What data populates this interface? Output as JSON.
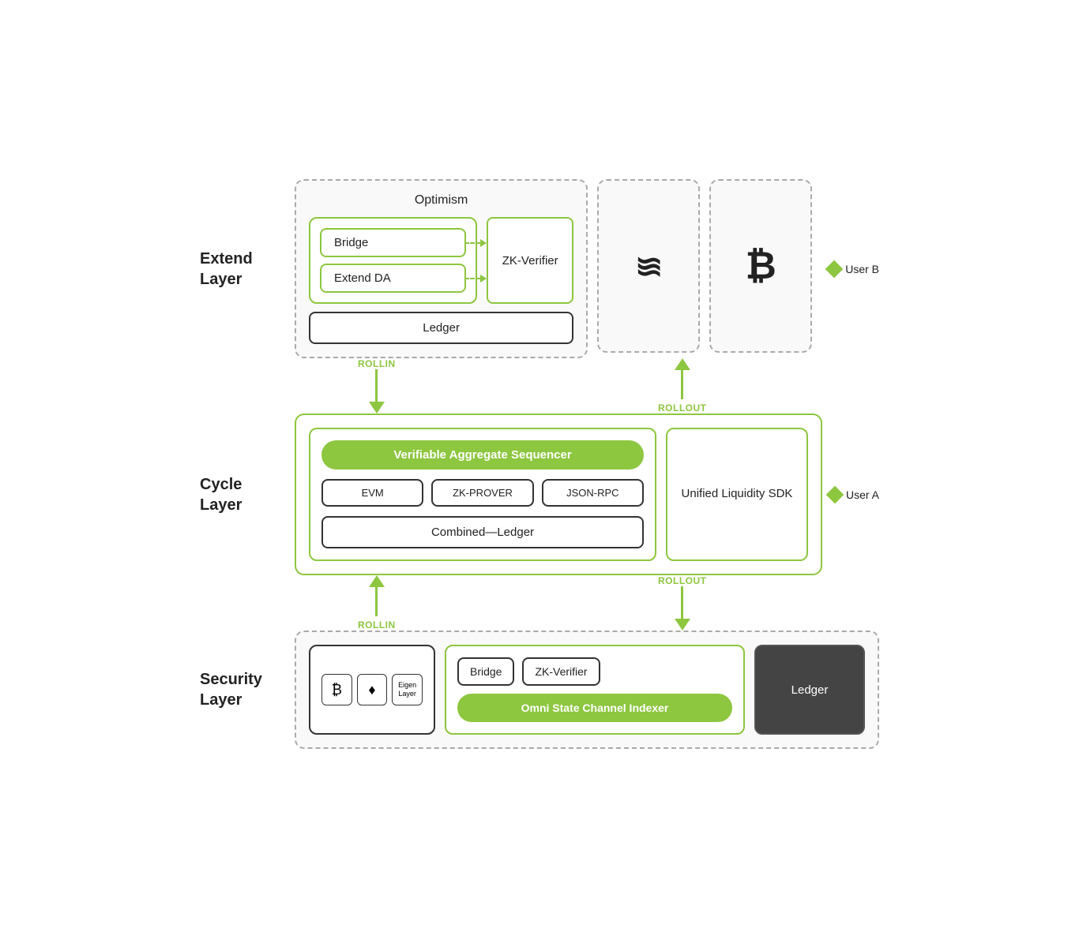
{
  "layers": {
    "extend": {
      "label": "Extend\nLayer",
      "title": "Optimism",
      "bridge_label": "Bridge",
      "extend_da_label": "Extend DA",
      "zk_verifier_label": "ZK-Verifier",
      "ledger_label": "Ledger"
    },
    "cycle": {
      "label": "Cycle\nLayer",
      "sequencer_label": "Verifiable Aggregate Sequencer",
      "evm_label": "EVM",
      "zk_prover_label": "ZK-PROVER",
      "json_rpc_label": "JSON-RPC",
      "combined_ledger_label": "Combined—Ledger",
      "unified_label": "Unified\nLiquidity\nSDK"
    },
    "security": {
      "label": "Security\nLayer",
      "bridge_label": "Bridge",
      "zk_verifier_label": "ZK-Verifier",
      "omni_label": "Omni State Channel Indexer",
      "ledger_label": "Ledger"
    }
  },
  "arrows": {
    "rollin_1": "ROLLIN",
    "rollout_1": "ROLLOUT",
    "rollin_2": "ROLLIN",
    "rollout_2": "ROLLOUT"
  },
  "users": {
    "user_a": "User A",
    "user_b": "User B"
  },
  "icons": {
    "bitcoin": "₿",
    "ethereum": "Ξ",
    "solana": "≡"
  }
}
